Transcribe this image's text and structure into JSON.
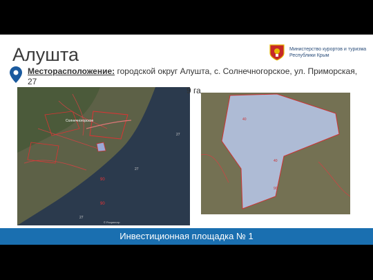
{
  "title": "Алушта",
  "location": {
    "label": "Месторасположение:",
    "text": " городской округ Алушта, с. Солнечногорское, ул. Приморская,",
    "text_cont": "27"
  },
  "area_text": "9 га",
  "ministry": {
    "line1": "Министерство курортов и туризма",
    "line2": "Республики Крым"
  },
  "map1": {
    "place_label": "Солнечногорское",
    "copyright": "© Росреестр"
  },
  "banner": "Инвестиционная площадка № 1",
  "colors": {
    "banner": "#1a6fb0",
    "pin": "#1a5a9e",
    "plot_fill": "#b9c8ec",
    "sea": "#2b3a4d"
  }
}
